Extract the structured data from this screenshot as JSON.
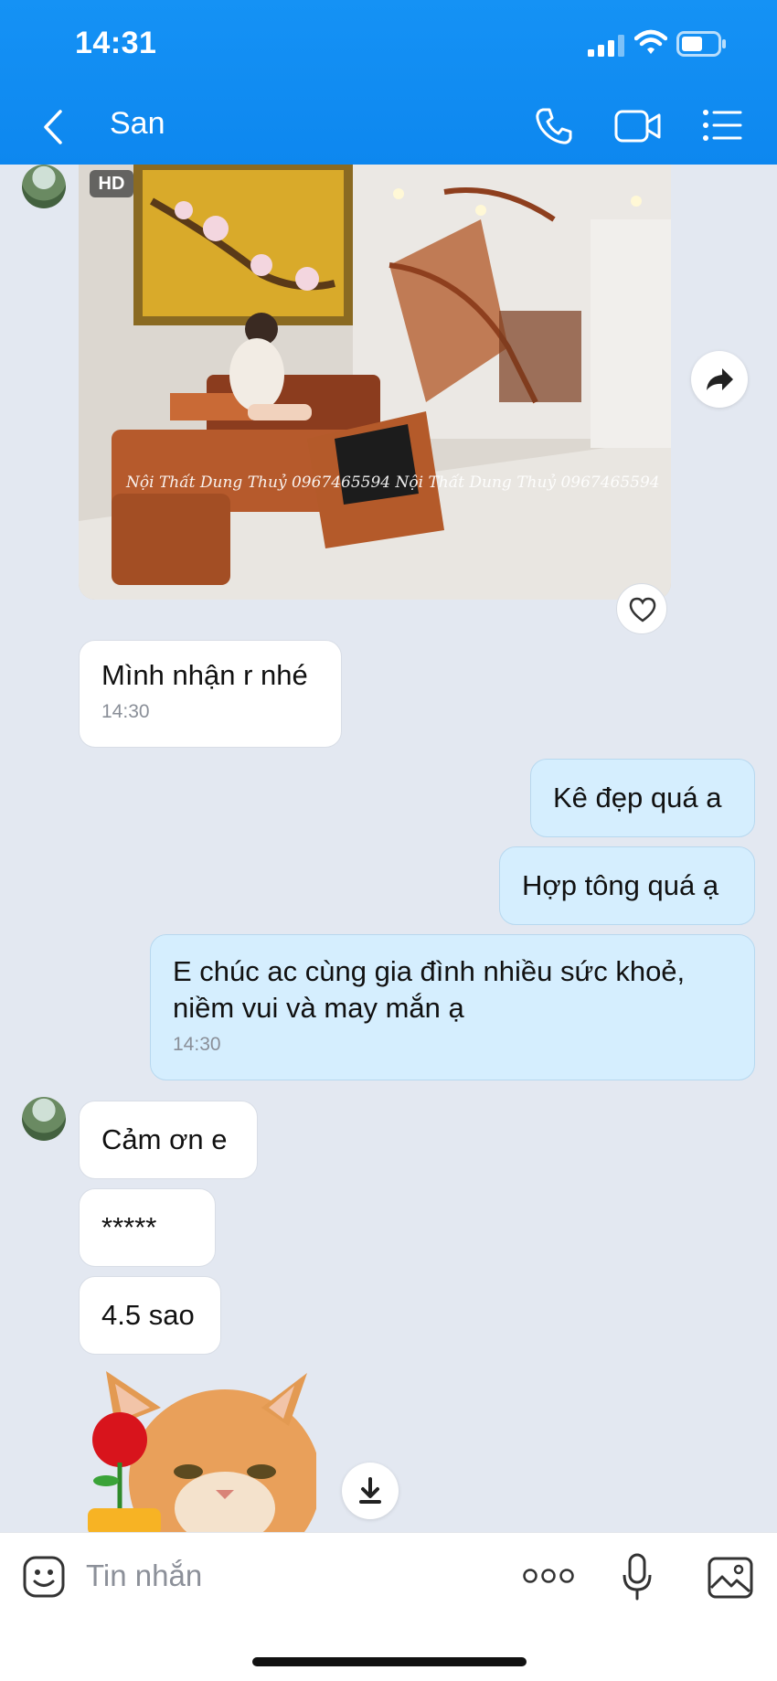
{
  "status_bar": {
    "time": "14:31"
  },
  "header": {
    "title": "San"
  },
  "photo": {
    "badge": "HD",
    "watermark": "Nội Thất Dung Thuỷ 0967465594 Nội Thất Dung Thuỷ 0967465594"
  },
  "messages": [
    {
      "direction": "in",
      "text": "Mình nhận r nhé",
      "time": "14:30"
    },
    {
      "direction": "out",
      "text": "Kê đẹp quá a"
    },
    {
      "direction": "out",
      "text": "Hợp tông quá ạ"
    },
    {
      "direction": "out",
      "lines": [
        "E chúc ac cùng gia đình nhiều sức khoẻ,",
        "niềm vui và may mắn ạ"
      ],
      "time": "14:30"
    },
    {
      "direction": "in",
      "text": "Cảm ơn e"
    },
    {
      "direction": "in",
      "text": "*****"
    },
    {
      "direction": "in",
      "text": "4.5 sao"
    }
  ],
  "input": {
    "placeholder": "Tin nhắn"
  },
  "colors": {
    "header": "#1592f5",
    "chat_bg": "#e3e8f1",
    "outgoing_bubble": "#d5eefe",
    "incoming_bubble": "#ffffff"
  },
  "icons": [
    "back-icon",
    "phone-icon",
    "video-camera-icon",
    "list-menu-icon",
    "forward-icon",
    "heart-icon",
    "download-icon",
    "emoji-icon",
    "more-dots-icon",
    "microphone-icon",
    "image-gallery-icon"
  ]
}
